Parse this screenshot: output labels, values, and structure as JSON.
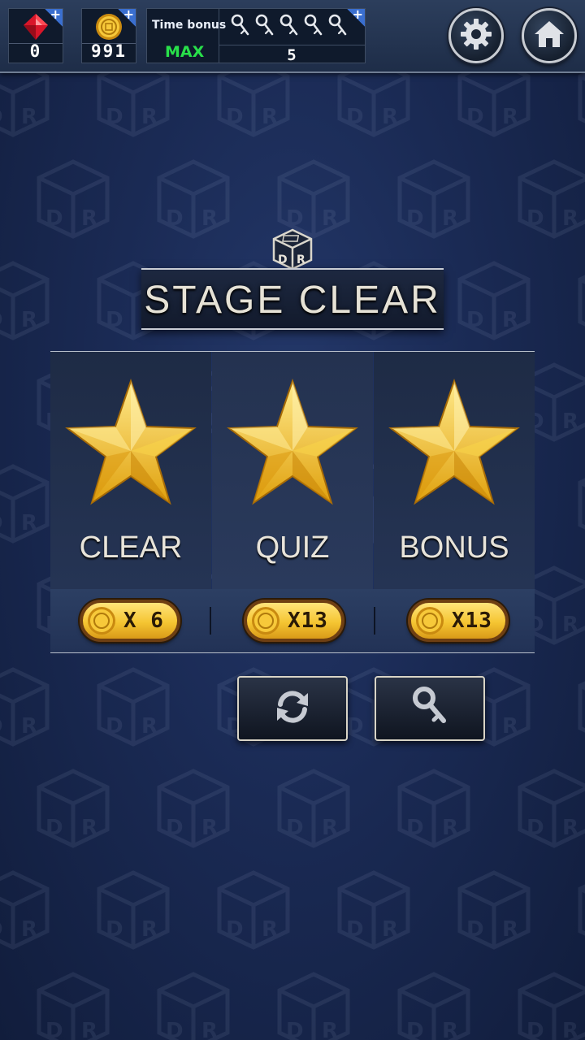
{
  "resources": {
    "gems": {
      "value": "0",
      "icon": "red-gem-icon"
    },
    "coins": {
      "value": "991",
      "icon": "gold-coin-icon"
    },
    "time_bonus": {
      "label": "Time bonus",
      "status": "MAX",
      "keys_count": "5",
      "icon": "key-icon"
    }
  },
  "buttons": {
    "settings_icon": "gear-icon",
    "home_icon": "home-icon"
  },
  "title": "STAGE CLEAR",
  "results": [
    {
      "label": "CLEAR",
      "reward": "X 6"
    },
    {
      "label": "QUIZ",
      "reward": "X13"
    },
    {
      "label": "BONUS",
      "reward": "X13"
    }
  ],
  "actions": {
    "retry_icon": "refresh-icon",
    "hint_icon": "key-icon"
  },
  "colors": {
    "accent_gold": "#f5c532",
    "status_green": "#28e04a",
    "background": "#1a2a54"
  }
}
